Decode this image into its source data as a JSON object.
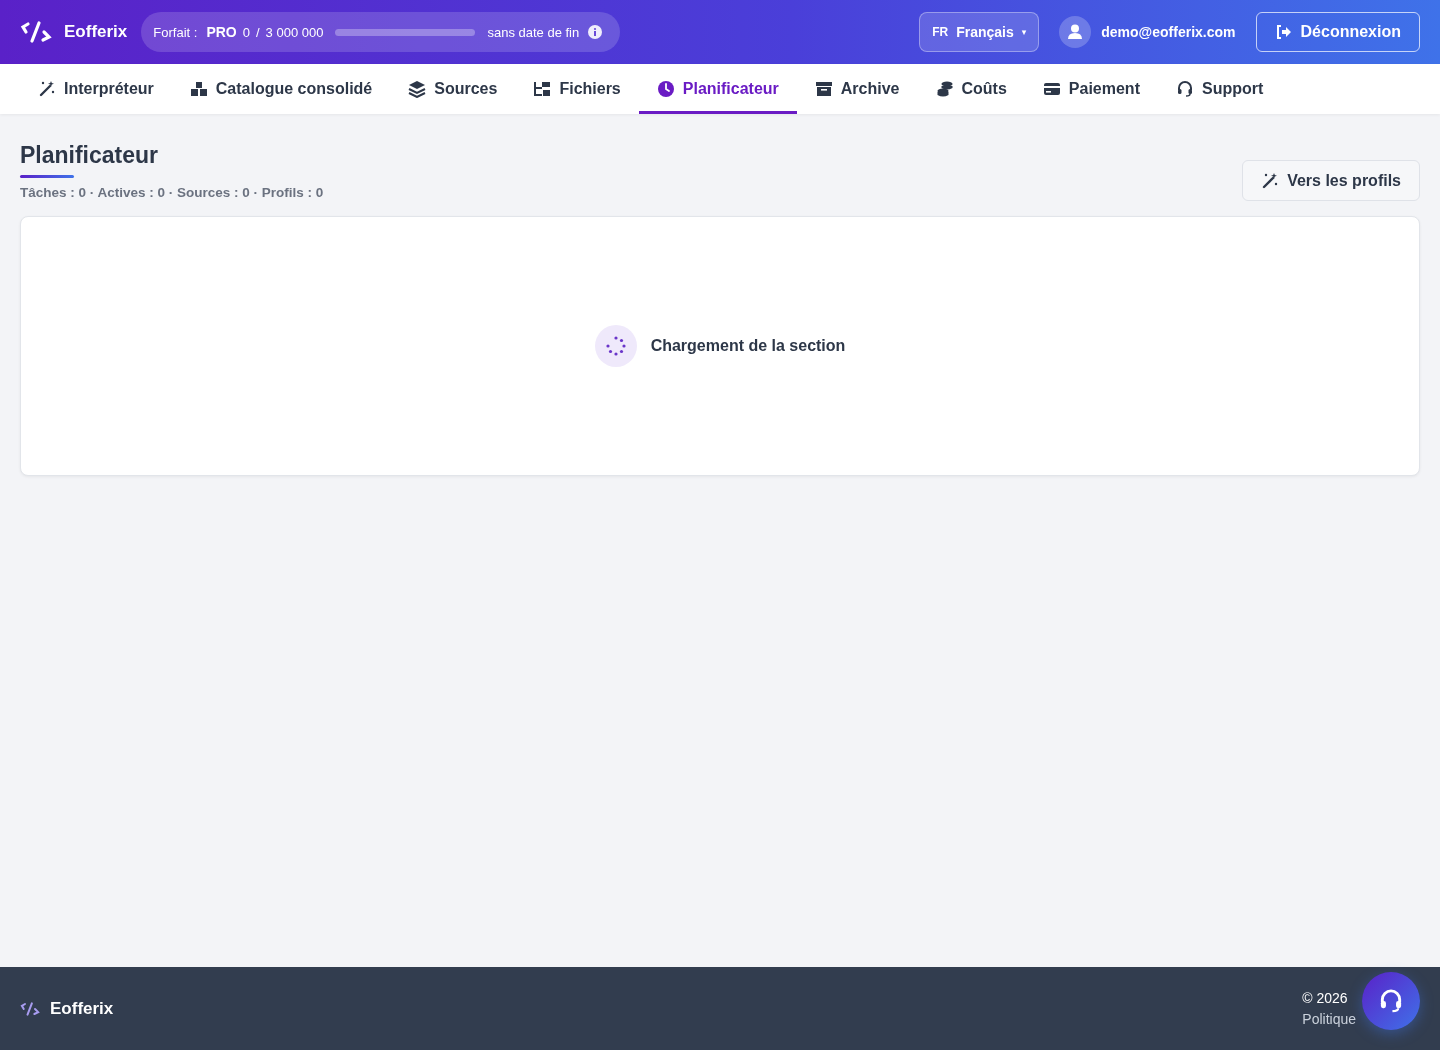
{
  "header": {
    "brand": "Eofferix",
    "plan": {
      "label": "Forfait :",
      "name": "PRO",
      "used": "0",
      "separator": "/",
      "quota": "3 000 000",
      "level": 0,
      "expiry": "sans date de fin"
    },
    "language": {
      "code": "FR",
      "name": "Français",
      "caret": "▾"
    },
    "user": {
      "email": "demo@eofferix.com"
    },
    "logout": "Déconnexion"
  },
  "tabs": [
    {
      "label": "Interpréteur",
      "selected": false
    },
    {
      "label": "Catalogue consolidé",
      "selected": false
    },
    {
      "label": "Sources",
      "selected": false
    },
    {
      "label": "Fichiers",
      "selected": false
    },
    {
      "label": "Planificateur",
      "selected": true
    },
    {
      "label": "Archive",
      "selected": false
    },
    {
      "label": "Coûts",
      "selected": false
    },
    {
      "label": "Paiement",
      "selected": false
    },
    {
      "label": "Support",
      "selected": false
    }
  ],
  "page": {
    "title": "Planificateur",
    "stats": "Tâches : 0 · Actives : 0 · Sources : 0 · Profils : 0",
    "profiles_button": "Vers les profils",
    "loading": "Chargement de la section"
  },
  "footer": {
    "brand": "Eofferix",
    "copyright": "© 2026",
    "links": [
      "Politique"
    ]
  }
}
